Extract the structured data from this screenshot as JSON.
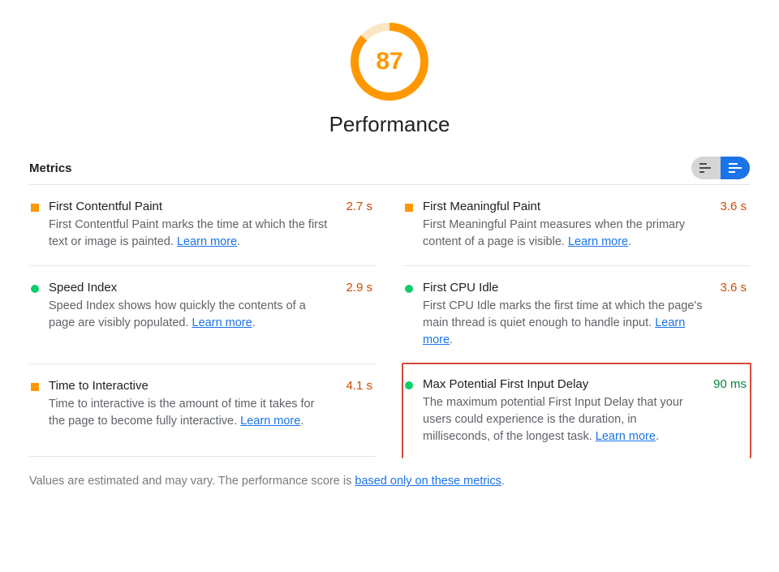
{
  "gauge": {
    "score": "87",
    "title": "Performance"
  },
  "section_title": "Metrics",
  "metrics": [
    {
      "status": "orange",
      "title": "First Contentful Paint",
      "desc_pre": "First Contentful Paint marks the time at which the first text or image is painted. ",
      "learn": "Learn more",
      "desc_post": ".",
      "value": "2.7 s",
      "value_color": "orange"
    },
    {
      "status": "orange",
      "title": "First Meaningful Paint",
      "desc_pre": "First Meaningful Paint measures when the primary content of a page is visible. ",
      "learn": "Learn more",
      "desc_post": ".",
      "value": "3.6 s",
      "value_color": "orange"
    },
    {
      "status": "green",
      "title": "Speed Index",
      "desc_pre": "Speed Index shows how quickly the contents of a page are visibly populated. ",
      "learn": "Learn more",
      "desc_post": ".",
      "value": "2.9 s",
      "value_color": "orange"
    },
    {
      "status": "green",
      "title": "First CPU Idle",
      "desc_pre": "First CPU Idle marks the first time at which the page's main thread is quiet enough to handle input. ",
      "learn": "Learn more",
      "desc_post": ".",
      "value": "3.6 s",
      "value_color": "orange"
    },
    {
      "status": "orange",
      "title": "Time to Interactive",
      "desc_pre": "Time to interactive is the amount of time it takes for the page to become fully interactive. ",
      "learn": "Learn more",
      "desc_post": ".",
      "value": "4.1 s",
      "value_color": "orange"
    },
    {
      "status": "green",
      "title": "Max Potential First Input Delay",
      "desc_pre": "The maximum potential First Input Delay that your users could experience is the duration, in milliseconds, of the longest task. ",
      "learn": "Learn more",
      "desc_post": ".",
      "value": "90 ms",
      "value_color": "green",
      "highlight": true
    }
  ],
  "footer_pre": "Values are estimated and may vary. The performance score is ",
  "footer_link": "based only on these metrics",
  "footer_post": "."
}
